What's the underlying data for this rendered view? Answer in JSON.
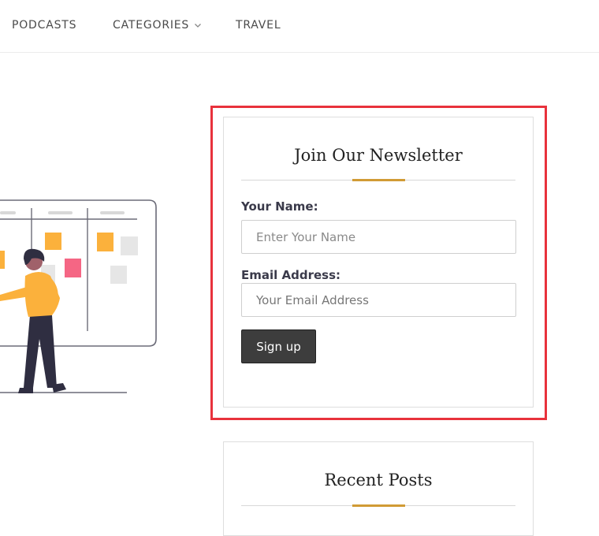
{
  "nav": {
    "items": [
      {
        "label": "PODCASTS"
      },
      {
        "label": "CATEGORIES"
      },
      {
        "label": "TRAVEL"
      }
    ]
  },
  "newsletter": {
    "title": "Join Our Newsletter",
    "name_label": "Your Name:",
    "name_placeholder": "Enter Your Name",
    "email_label": "Email Address:",
    "email_placeholder": "Your Email Address",
    "submit_label": "Sign up"
  },
  "recent_posts": {
    "title": "Recent Posts"
  },
  "colors": {
    "accent": "#d19b35",
    "highlight": "#e8323c",
    "button": "#3d3d3d"
  }
}
